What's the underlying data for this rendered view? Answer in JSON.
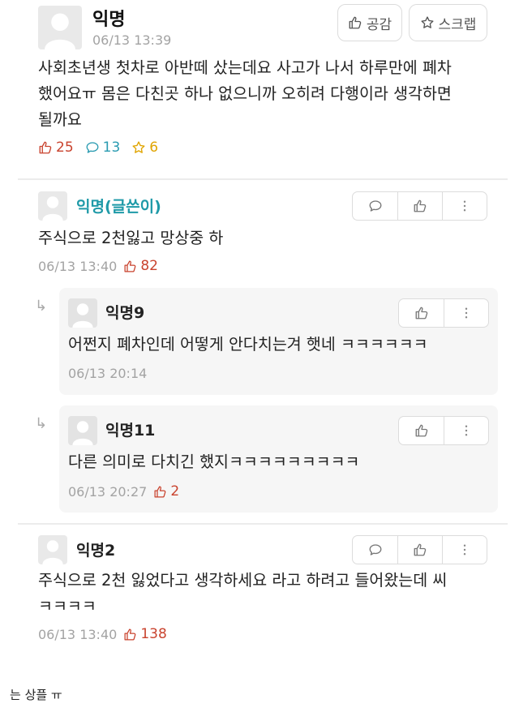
{
  "post": {
    "author": "익명",
    "time": "06/13 13:39",
    "like_label": "공감",
    "scrap_label": "스크랩",
    "body": "사회초년생 첫차로 아반떼 샀는데요 사고가 나서 하루만에 폐차\n했어요ㅠ 몸은 다친곳 하나 없으니까 오히려 다행이라 생각하면\n될까요",
    "stats": {
      "likes": "25",
      "comments": "13",
      "scraps": "6"
    }
  },
  "comments": [
    {
      "author": "익명(글쓴이)",
      "text": "주식으로 2천잃고 망상중 하",
      "time": "06/13 13:40",
      "votes": "82"
    },
    {
      "author": "익명2",
      "text": "주식으로 2천 잃었다고 생각하세요 라고 하려고 들어왔는데 씨\nㅋㅋㅋㅋ",
      "time": "06/13 13:40",
      "votes": "138"
    }
  ],
  "replies": [
    {
      "author": "익명9",
      "text": "어쩐지 폐차인데 어떻게 안다치는겨 햇네 ㅋㅋㅋㅋㅋㅋ",
      "time": "06/13 20:14"
    },
    {
      "author": "익명11",
      "text": "다른 의미로 다치긴 했지ㅋㅋㅋㅋㅋㅋㅋㅋㅋ",
      "time": "06/13 20:27",
      "votes": "2"
    }
  ],
  "reply_arrow": "↳",
  "footnote": "는 상플 ㅠ",
  "colors": {
    "like_red": "#c9432e",
    "comment_teal": "#2a9bb1",
    "scrap_yellow": "#e0a400",
    "op_author": "#1f9aa8"
  },
  "icons": [
    "avatar-icon",
    "thumbs-up-icon",
    "star-icon",
    "speech-bubble-icon",
    "more-vertical-icon"
  ]
}
